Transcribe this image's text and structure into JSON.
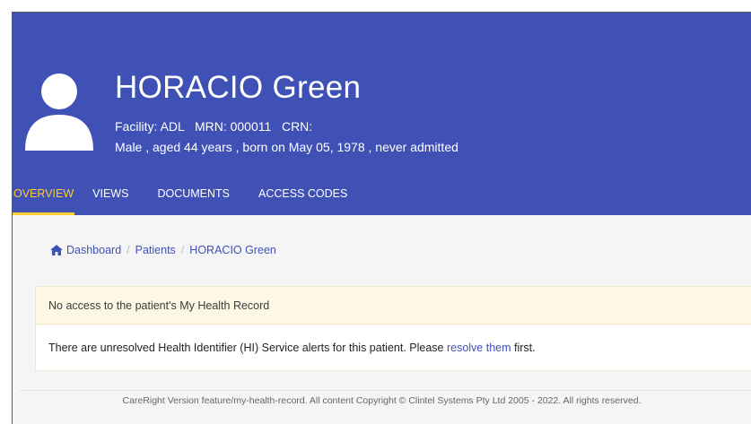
{
  "patient": {
    "name": "HORACIO Green",
    "facility_line": "Facility: ADL   MRN: 000011   CRN:",
    "details_line": "Male , aged 44 years , born on May 05, 1978 , never admitted"
  },
  "tabs": [
    {
      "label": "OVERVIEW",
      "active": true
    },
    {
      "label": "VIEWS",
      "active": false
    },
    {
      "label": "DOCUMENTS",
      "active": false
    },
    {
      "label": "ACCESS CODES",
      "active": false
    }
  ],
  "breadcrumb": {
    "items": [
      "Dashboard",
      "Patients",
      "HORACIO Green"
    ],
    "separator": "/"
  },
  "alert": {
    "heading": "No access to the patient's My Health Record",
    "message_before": "There are unresolved Health Identifier (HI) Service alerts for this patient. Please ",
    "link_text": "resolve them",
    "message_after": " first."
  },
  "footer": {
    "text": "CareRight Version feature/my-health-record. All content Copyright © Clintel Systems Pty Ltd 2005 - 2022. All rights reserved."
  },
  "colors": {
    "header_bg": "#3f51b5",
    "active_tab": "#ffcc33",
    "alert_bg": "#fcf8e3",
    "link": "#3f51b5"
  },
  "icons": {
    "avatar": "person-icon",
    "breadcrumb_home": "home-icon"
  }
}
